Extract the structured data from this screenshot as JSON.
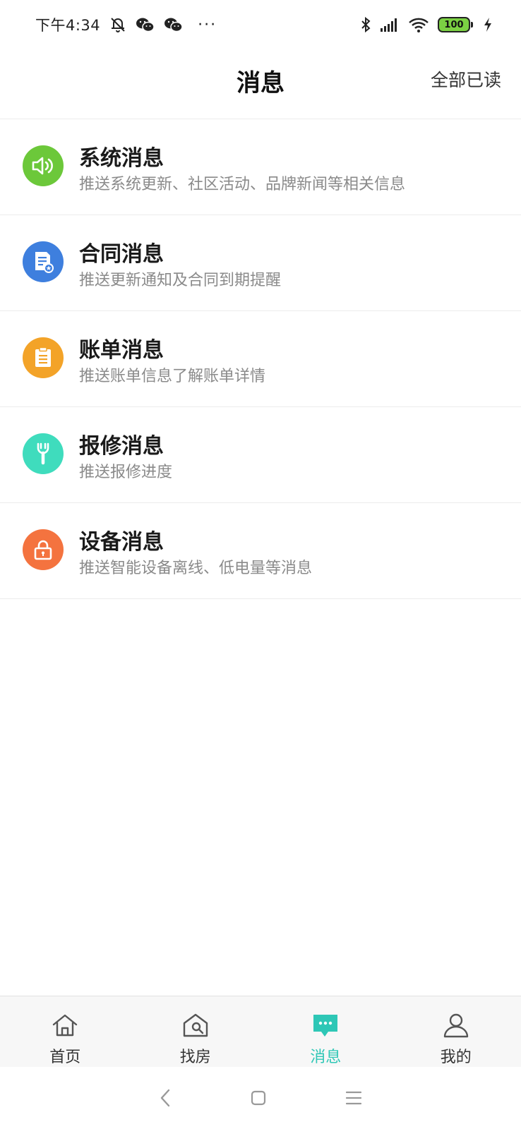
{
  "status_bar": {
    "time": "下午4:34",
    "dots": "···",
    "battery": "100",
    "icons": [
      "mute-bell-icon",
      "wechat-icon",
      "wechat-icon",
      "bluetooth-icon",
      "signal-icon",
      "wifi-icon",
      "charging-icon"
    ]
  },
  "header": {
    "title": "消息",
    "action": "全部已读"
  },
  "messages": [
    {
      "title": "系统消息",
      "desc": "推送系统更新、社区活动、品牌新闻等相关信息",
      "icon": "speaker-icon",
      "color": "#6cc83a"
    },
    {
      "title": "合同消息",
      "desc": "推送更新通知及合同到期提醒",
      "icon": "contract-icon",
      "color": "#3e7fde"
    },
    {
      "title": "账单消息",
      "desc": "推送账单信息了解账单详情",
      "icon": "bill-icon",
      "color": "#f3a328"
    },
    {
      "title": "报修消息",
      "desc": "推送报修进度",
      "icon": "wrench-icon",
      "color": "#3fdcbd"
    },
    {
      "title": "设备消息",
      "desc": "推送智能设备离线、低电量等消息",
      "icon": "lock-icon",
      "color": "#f4733f"
    }
  ],
  "tabs": [
    {
      "label": "首页",
      "icon": "home-icon",
      "active": false
    },
    {
      "label": "找房",
      "icon": "house-search-icon",
      "active": false
    },
    {
      "label": "消息",
      "icon": "chat-icon",
      "active": true
    },
    {
      "label": "我的",
      "icon": "user-icon",
      "active": false
    }
  ],
  "colors": {
    "accent": "#2ec7b6",
    "title_text": "#1a1a1a",
    "desc_text": "#8a8a8a"
  }
}
